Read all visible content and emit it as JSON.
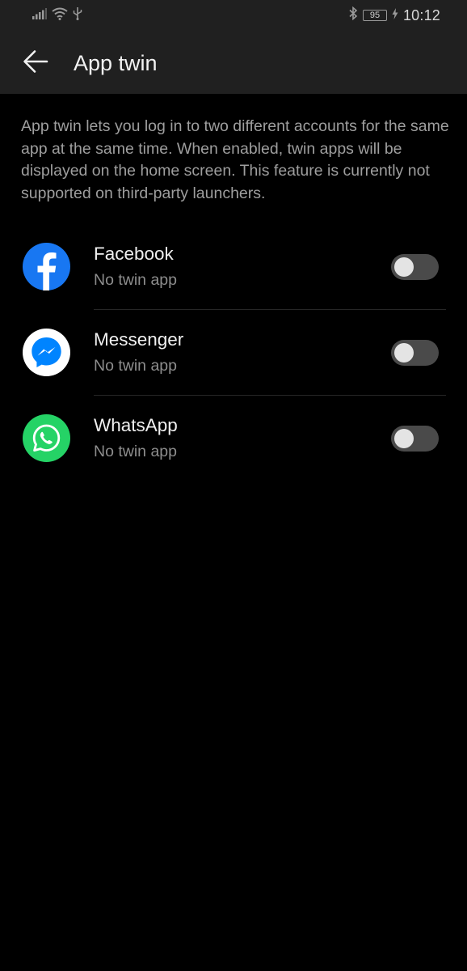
{
  "status_bar": {
    "icons": [
      "signal-icon",
      "wifi-icon",
      "usb-icon",
      "bluetooth-icon",
      "battery-icon",
      "charging-icon"
    ],
    "battery_level": "95",
    "time": "10:12"
  },
  "header": {
    "back_icon": "back-arrow-icon",
    "title": "App twin"
  },
  "description": "App twin lets you log in to two different accounts for the same app at the same time. When enabled, twin apps will be displayed on the home screen. This feature is currently not supported on third-party launchers.",
  "apps": [
    {
      "name": "Facebook",
      "status": "No twin app",
      "enabled": false,
      "icon": "facebook-icon",
      "color": "#1877F2"
    },
    {
      "name": "Messenger",
      "status": "No twin app",
      "enabled": false,
      "icon": "messenger-icon",
      "color": "#0084FF"
    },
    {
      "name": "WhatsApp",
      "status": "No twin app",
      "enabled": false,
      "icon": "whatsapp-icon",
      "color": "#25D366"
    }
  ],
  "colors": {
    "background": "#000000",
    "bar_background": "#202020",
    "toggle_off_track": "#4a4a4a",
    "toggle_knob": "#e4e4e4",
    "secondary_text": "#9e9e9e"
  }
}
